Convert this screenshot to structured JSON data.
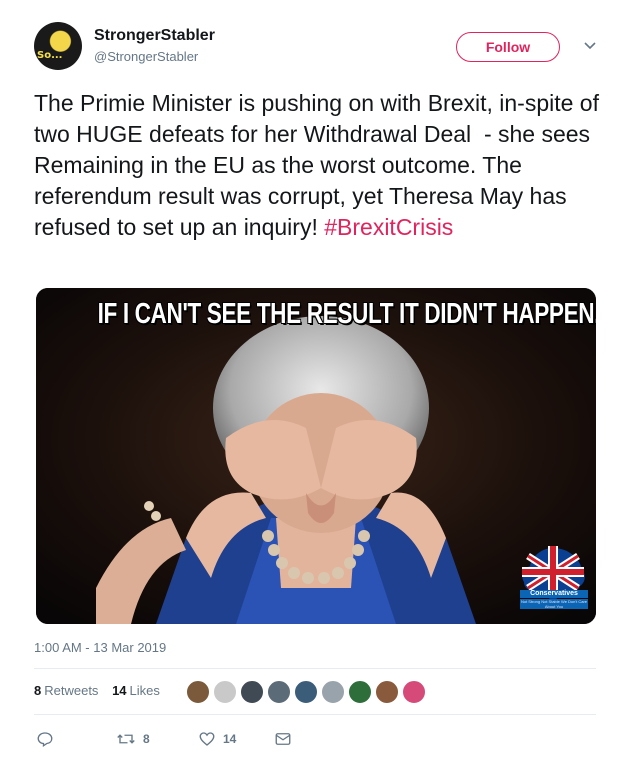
{
  "user": {
    "name": "StrongerStabler",
    "handle": "@StrongerStabler",
    "avatar_text": "So..."
  },
  "follow_label": "Follow",
  "tweet": {
    "text": "The Primie Minister is pushing on with Brexit, in-spite of two HUGE defeats for her Withdrawal Deal  - she sees Remaining in the EU as the worst outcome. The referendum result was corrupt, yet Theresa May has refused to set up an inquiry! ",
    "hashtag": "#BrexitCrisis"
  },
  "media": {
    "caption": "IF I CAN'T SEE THE RESULT IT DIDN'T HAPPEN...",
    "badge_title": "Conservatives",
    "badge_subtitle": "Not Strong Not Stable We Don't Care About You"
  },
  "timestamp": "1:00 AM - 13 Mar 2019",
  "stats": {
    "retweets_count": "8",
    "retweets_label": "Retweets",
    "likes_count": "14",
    "likes_label": "Likes"
  },
  "likers": [
    "#7a5a3a",
    "#c9c9c9",
    "#3f4a55",
    "#5c6b78",
    "#3b5d7a",
    "#98a3ab",
    "#2e6e3a",
    "#8a5a3c",
    "#d64a7a"
  ],
  "actions": {
    "reply_count": "",
    "retweet_count": "8",
    "like_count": "14"
  },
  "colors": {
    "accent": "#e0245e",
    "secondary_text": "#657786",
    "divider": "#e6ecf0"
  }
}
